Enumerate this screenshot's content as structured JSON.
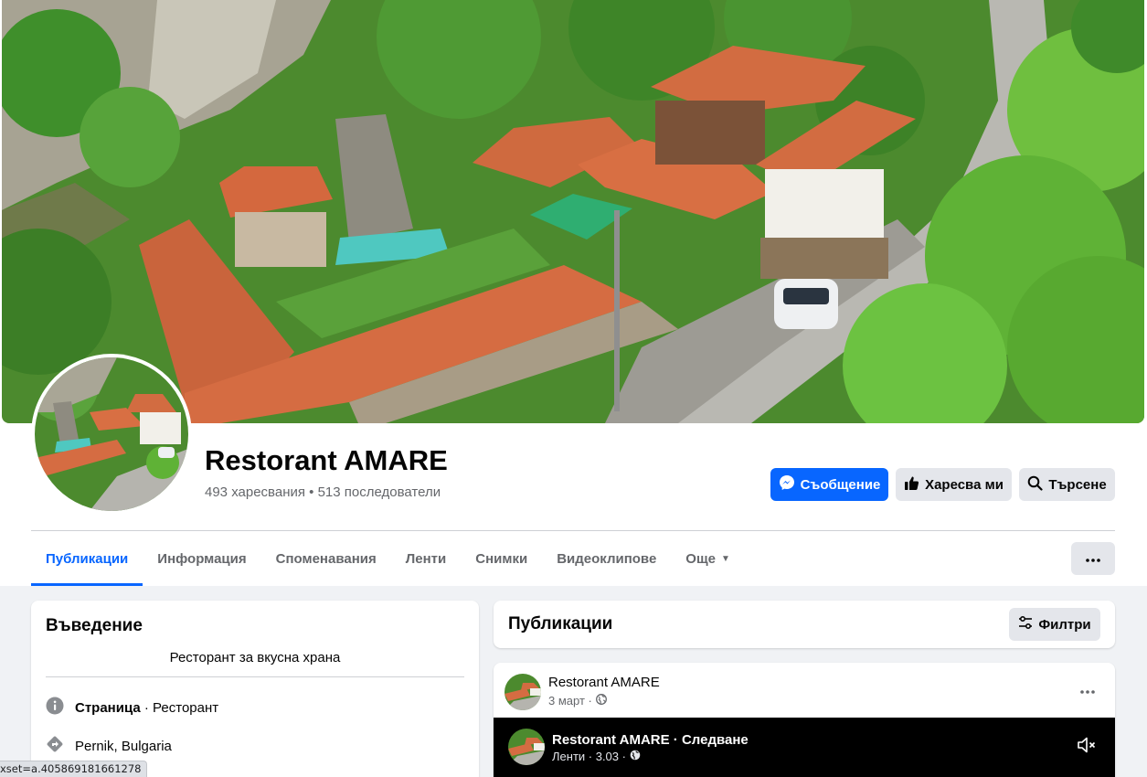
{
  "page": {
    "name": "Restorant AMARE",
    "stats": "493 харесвания • 513 последователи"
  },
  "actions": {
    "message": "Съобщение",
    "like": "Харесва ми",
    "search": "Търсене"
  },
  "tabs": [
    {
      "label": "Публикации",
      "active": true
    },
    {
      "label": "Информация"
    },
    {
      "label": "Споменавания"
    },
    {
      "label": "Ленти"
    },
    {
      "label": "Снимки"
    },
    {
      "label": "Видеоклипове"
    },
    {
      "label": "Още",
      "dropdown": true
    }
  ],
  "intro": {
    "title": "Въведение",
    "bio": "Ресторант за вкусна храна",
    "category_label": "Страница",
    "category_value": " · Ресторант",
    "location": "Pernik, Bulgaria"
  },
  "posts": {
    "title": "Публикации",
    "filters_label": "Филтри"
  },
  "post": {
    "author": "Restorant AMARE",
    "date": "3 март ·",
    "reel": {
      "title": "Restorant AMARE · Следване",
      "meta": "Ленти · 3.03 ·"
    }
  },
  "status_bar": {
    "url": "xset=a.405869181661278"
  },
  "colors": {
    "accent": "#0866ff",
    "secondary_text": "#65676b",
    "button_gray": "#e4e6eb",
    "page_bg": "#f0f2f5"
  },
  "icons": [
    "messenger-icon",
    "thumbs-up-icon",
    "search-icon",
    "ellipsis-icon",
    "sliders-icon",
    "info-icon",
    "directions-icon",
    "globe-icon",
    "muted-speaker-icon",
    "caret-down-icon"
  ]
}
